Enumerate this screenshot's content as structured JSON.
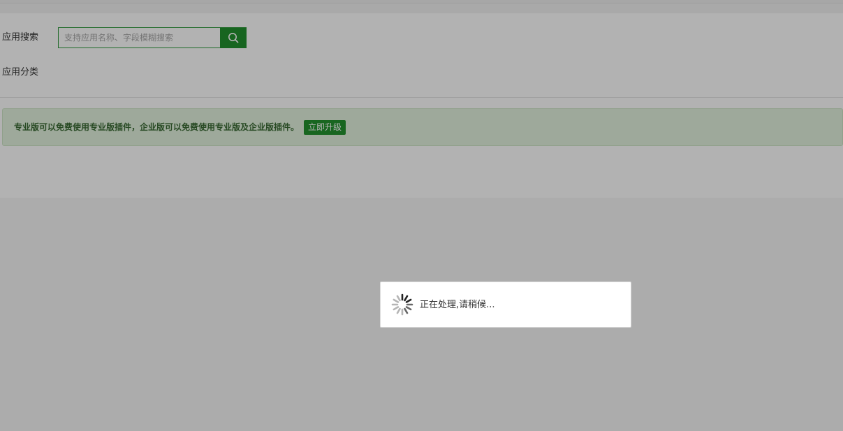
{
  "filters": {
    "search_label": "应用搜索",
    "search_placeholder": "支持应用名称、字段模糊搜索",
    "search_value": "",
    "category_label": "应用分类"
  },
  "notice": {
    "text": "专业版可以免费使用专业版插件，企业版可以免费使用专业版及企业版插件。",
    "upgrade_label": "立即升级"
  },
  "loading": {
    "message": "正在处理,请稍候..."
  },
  "colors": {
    "accent": "#21912f",
    "notice_bg": "#e3f2df",
    "notice_text": "#3a6b34",
    "overlay": "rgba(0,0,0,0.30)"
  },
  "icons": {
    "search": "search-icon",
    "spinner": "loading-spinner-icon"
  }
}
